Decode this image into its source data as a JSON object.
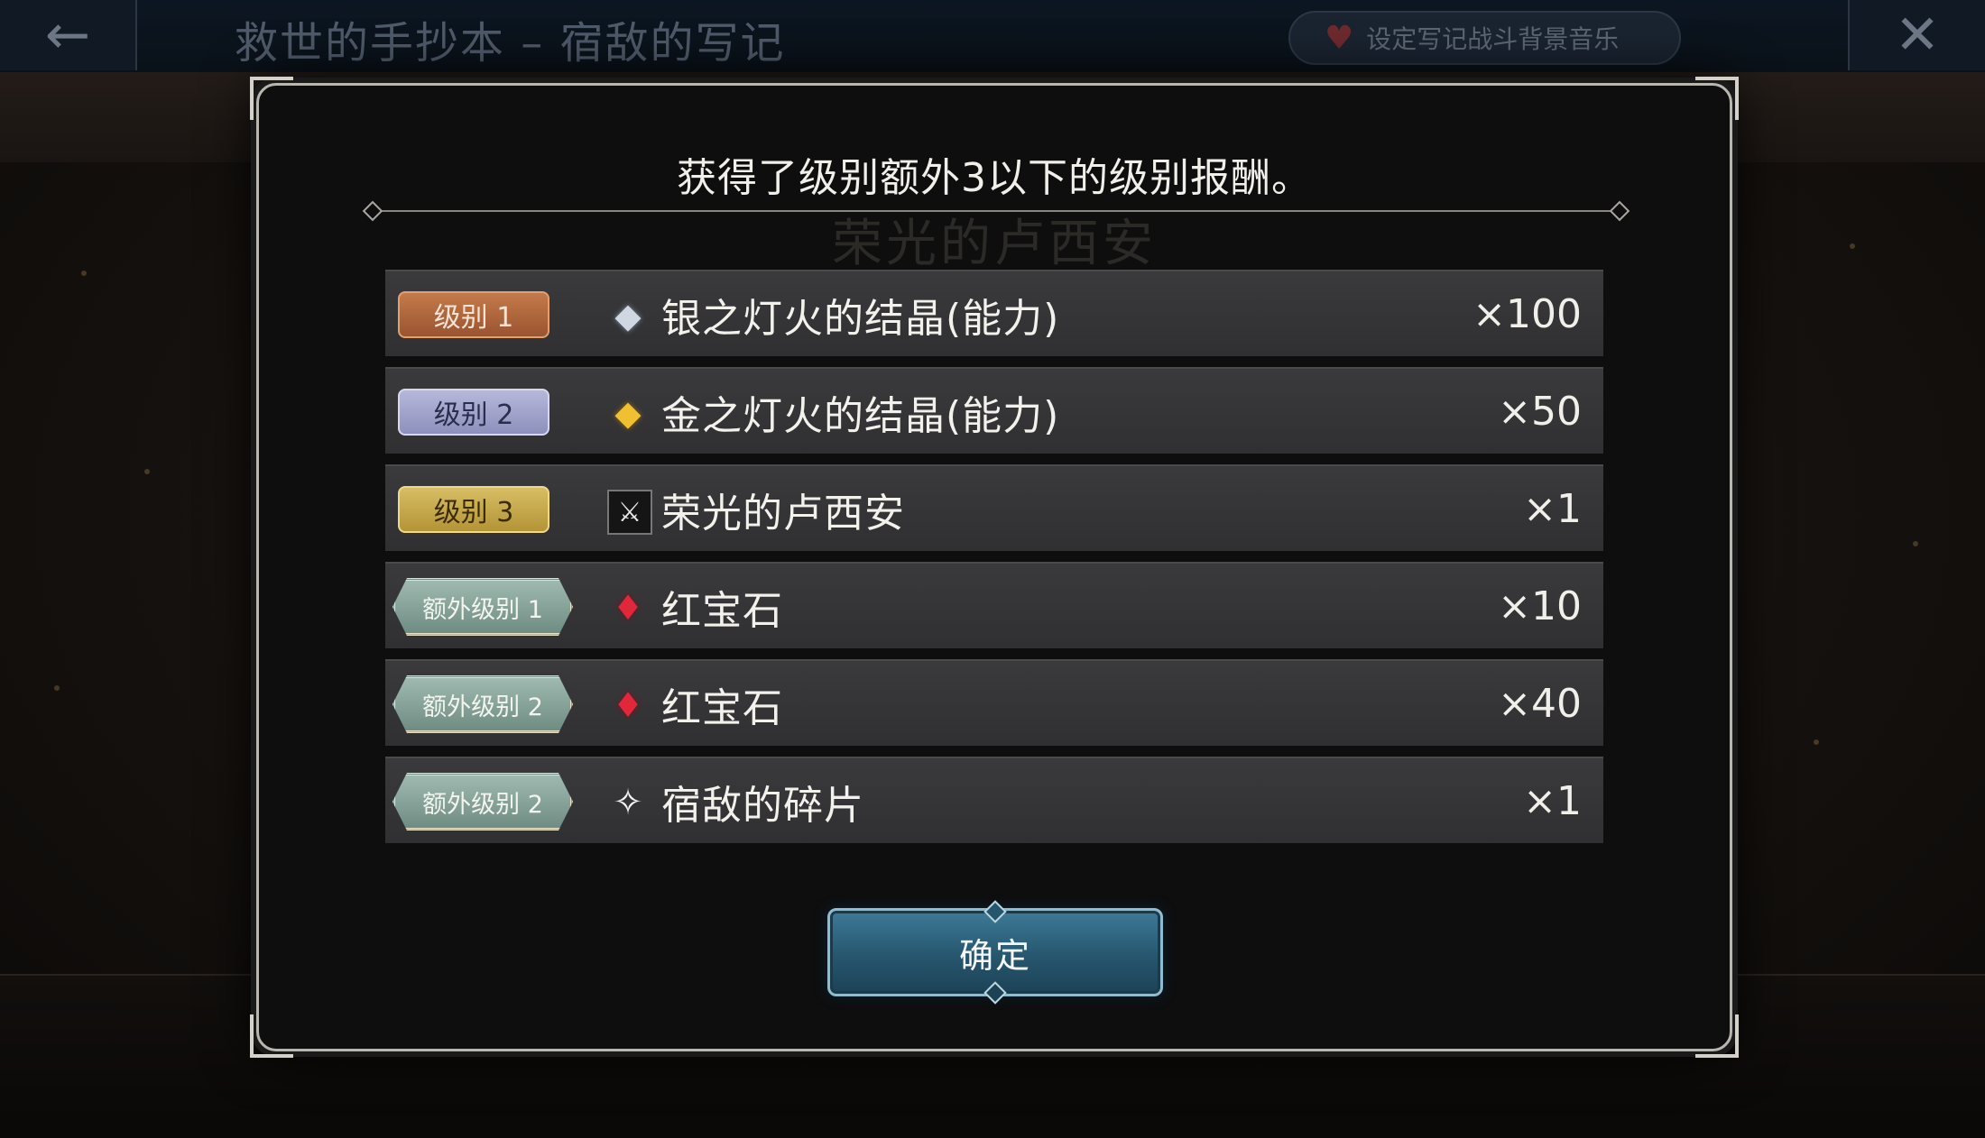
{
  "topbar": {
    "back_icon": "←",
    "title": "救世的手抄本 – 宿敌的写记",
    "bgm_label": "设定写记战斗背景音乐",
    "close_icon": "✕"
  },
  "modal": {
    "title": "获得了级别额外3以下的级别报酬。",
    "ghost_title": "荣光的卢西安",
    "confirm_label": "确定"
  },
  "rewards": [
    {
      "badge": "级别 1",
      "tier": "lv1",
      "icon": "silver-crystal-icon",
      "name": "银之灯火的结晶(能力)",
      "qty": "×100"
    },
    {
      "badge": "级别 2",
      "tier": "lv2",
      "icon": "gold-crystal-icon",
      "name": "金之灯火的结晶(能力)",
      "qty": "×50"
    },
    {
      "badge": "级别 3",
      "tier": "lv3",
      "icon": "character-card-icon",
      "name": "荣光的卢西安",
      "qty": "×1"
    },
    {
      "badge": "额外级别 1",
      "tier": "ex",
      "icon": "ruby-icon",
      "name": "红宝石",
      "qty": "×10"
    },
    {
      "badge": "额外级别 2",
      "tier": "ex",
      "icon": "ruby-icon",
      "name": "红宝石",
      "qty": "×40"
    },
    {
      "badge": "额外级别 2",
      "tier": "ex",
      "icon": "rival-shard-icon",
      "name": "宿敌的碎片",
      "qty": "×1"
    }
  ],
  "colors": {
    "confirm_button": "#26566e",
    "badge_level1": "#b06638",
    "badge_level2": "#a3a5cc",
    "badge_level3": "#c8aa4c",
    "badge_extra": "#87a59b"
  }
}
